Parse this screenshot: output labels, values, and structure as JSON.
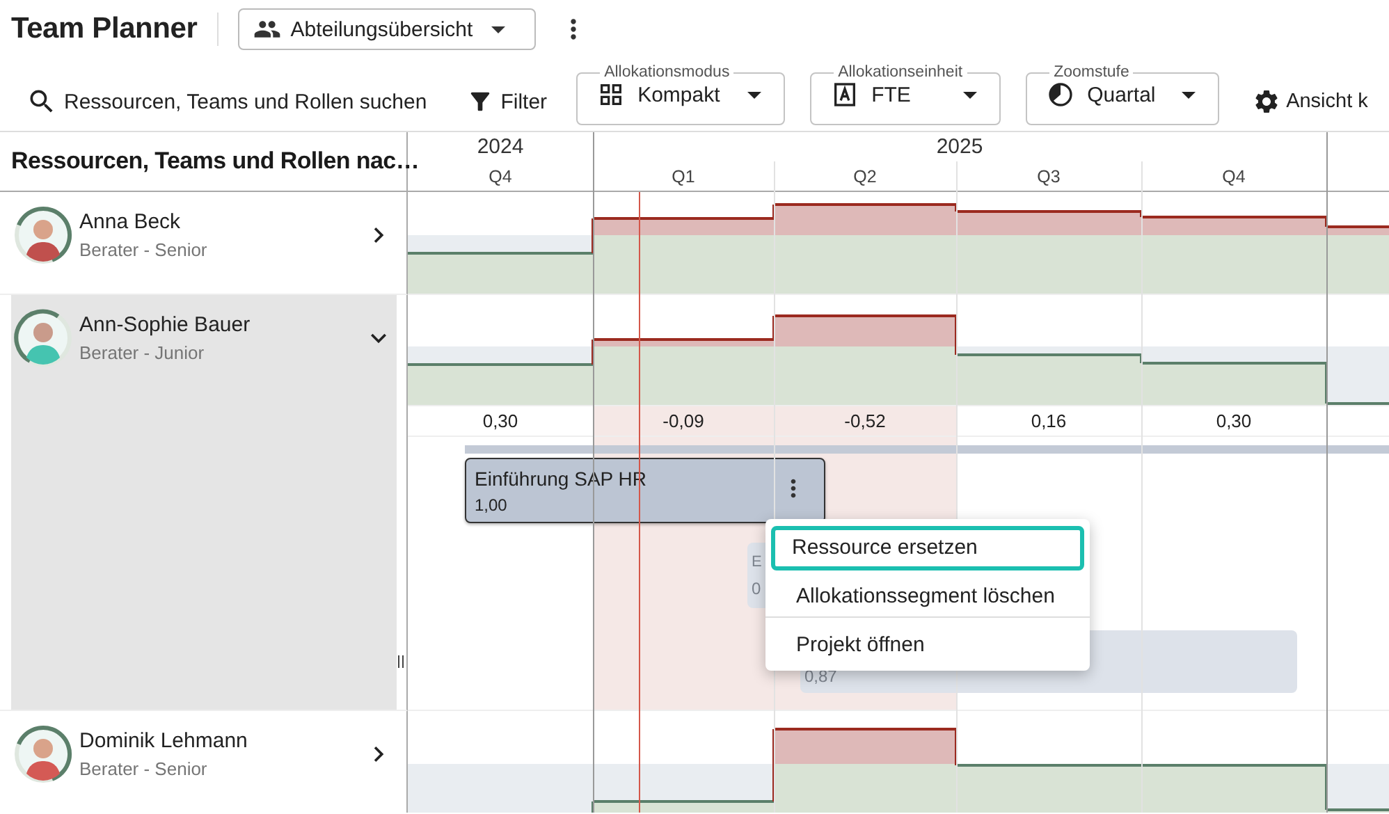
{
  "app": {
    "title": "Team Planner",
    "view_button": {
      "label": "Abteilungsübersicht"
    }
  },
  "toolbar": {
    "search": {
      "label": "Ressourcen, Teams und Rollen suchen"
    },
    "filter": {
      "label": "Filter"
    },
    "selects": [
      {
        "kind": "mode",
        "legend": "Allokationsmodus",
        "value": "Kompakt"
      },
      {
        "kind": "unit",
        "legend": "Allokationseinheit",
        "value": "FTE"
      },
      {
        "kind": "zoom",
        "legend": "Zoomstufe",
        "value": "Quartal"
      }
    ],
    "settings": {
      "label": "Ansicht k"
    }
  },
  "list_header": "Ressourcen, Teams und Rollen nac…",
  "timeline": {
    "years": [
      {
        "label": "2024",
        "quarters": [
          "Q4"
        ]
      },
      {
        "label": "2025",
        "quarters": [
          "Q1",
          "Q2",
          "Q3",
          "Q4"
        ]
      }
    ]
  },
  "resources": [
    {
      "name": "Anna Beck",
      "role": "Berater - Senior",
      "expanded": false
    },
    {
      "name": "Ann-Sophie Bauer",
      "role": "Berater - Junior",
      "expanded": true,
      "balance": [
        {
          "value": "0,30",
          "overallocated": false
        },
        {
          "value": "-0,09",
          "overallocated": true
        },
        {
          "value": "-0,52",
          "overallocated": true
        },
        {
          "value": "0,16",
          "overallocated": false
        },
        {
          "value": "0,30",
          "overallocated": false
        }
      ],
      "allocations": [
        {
          "title": "Einführung SAP HR",
          "value": "1,00",
          "selected": true
        },
        {
          "title": "E",
          "value": "0",
          "selected": false
        },
        {
          "value": "0,87",
          "selected": false
        }
      ]
    },
    {
      "name": "Dominik Lehmann",
      "role": "Berater - Senior",
      "expanded": false
    }
  ],
  "context_menu": {
    "items": [
      {
        "label": "Ressource ersetzen",
        "selected": true
      },
      {
        "label": "Allokationssegment löschen",
        "selected": false
      },
      {
        "label": "Projekt öffnen",
        "selected": false
      }
    ]
  }
}
